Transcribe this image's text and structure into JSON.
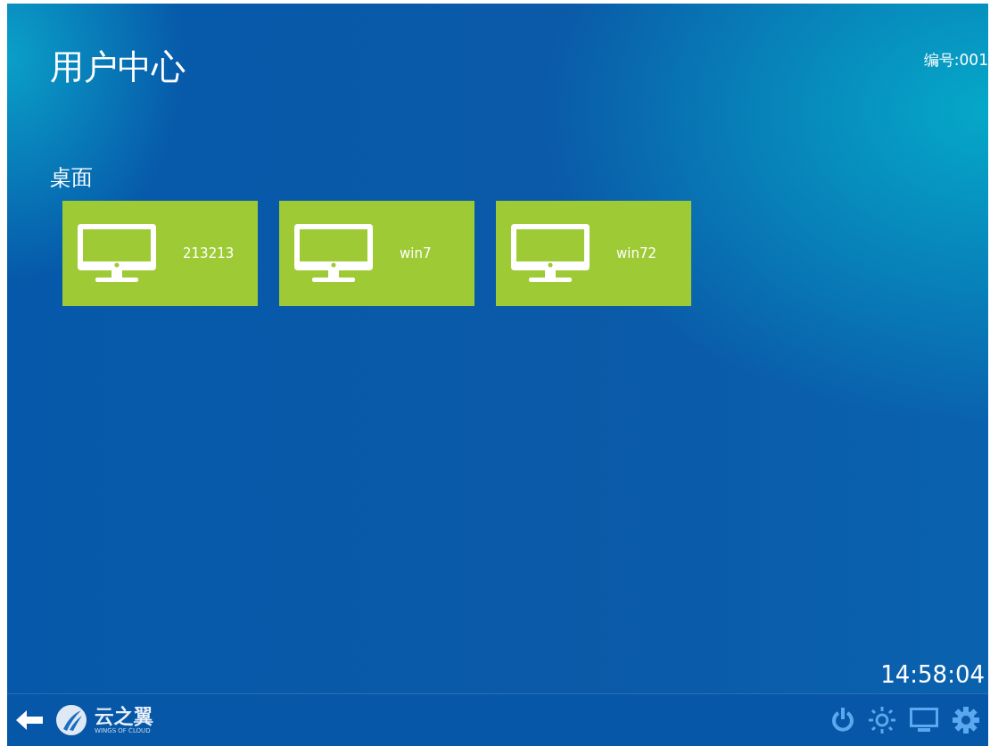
{
  "header": {
    "title": "用户中心",
    "device_number": "编号:001"
  },
  "section": {
    "title": "桌面"
  },
  "desktops": [
    {
      "name": "213213"
    },
    {
      "name": "win7"
    },
    {
      "name": "win72"
    }
  ],
  "clock": "14:58:04",
  "taskbar": {
    "logo_name": "云之翼",
    "logo_tagline": "WINGS OF CLOUD"
  }
}
